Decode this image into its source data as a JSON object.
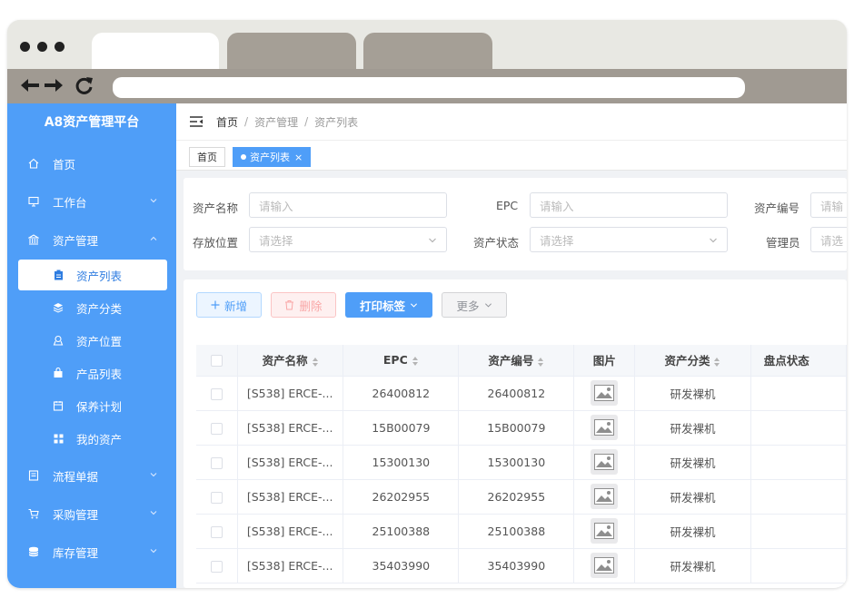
{
  "colors": {
    "primary": "#4f9ef8",
    "sidebar_bg": "#4f9ef8",
    "browser_bar": "#a09a92",
    "danger_light": "#f9a7a7"
  },
  "browser": {
    "icons": [
      "back-icon",
      "forward-icon",
      "reload-icon"
    ]
  },
  "app": {
    "title": "A8资产管理平台"
  },
  "sidebar": {
    "items": [
      {
        "label": "首页",
        "icon": "home-icon"
      },
      {
        "label": "工作台",
        "icon": "monitor-icon"
      },
      {
        "label": "资产管理",
        "icon": "bank-icon"
      },
      {
        "label": "流程单据",
        "icon": "document-icon"
      },
      {
        "label": "采购管理",
        "icon": "cart-icon"
      },
      {
        "label": "库存管理",
        "icon": "database-icon"
      }
    ],
    "sub_items": [
      {
        "label": "资产列表",
        "icon": "clipboard-icon",
        "active": true
      },
      {
        "label": "资产分类",
        "icon": "layers-icon"
      },
      {
        "label": "资产位置",
        "icon": "location-icon"
      },
      {
        "label": "产品列表",
        "icon": "bag-icon"
      },
      {
        "label": "保养计划",
        "icon": "calendar-icon"
      },
      {
        "label": "我的资产",
        "icon": "grid-icon"
      }
    ]
  },
  "breadcrumb": [
    "首页",
    "资产管理",
    "资产列表"
  ],
  "tags": [
    {
      "label": "首页"
    },
    {
      "label": "资产列表",
      "active": true
    }
  ],
  "filters": {
    "asset_name": {
      "label": "资产名称",
      "placeholder": "请输入"
    },
    "epc": {
      "label": "EPC",
      "placeholder": "请输入"
    },
    "asset_code": {
      "label": "资产编号",
      "placeholder": "请输"
    },
    "location": {
      "label": "存放位置",
      "placeholder": "请选择"
    },
    "status": {
      "label": "资产状态",
      "placeholder": "请选择"
    },
    "manager": {
      "label": "管理员",
      "placeholder": "请选"
    }
  },
  "actions": {
    "add": "新增",
    "delete": "删除",
    "print": "打印标签",
    "more": "更多"
  },
  "table": {
    "columns": [
      "资产名称",
      "EPC",
      "资产编号",
      "图片",
      "资产分类",
      "盘点状态"
    ],
    "rows": [
      {
        "name": "[S538] ERCE-...",
        "epc": "26400812",
        "code": "26400812",
        "category": "研发裸机"
      },
      {
        "name": "[S538] ERCE-...",
        "epc": "15B00079",
        "code": "15B00079",
        "category": "研发裸机"
      },
      {
        "name": "[S538] ERCE-...",
        "epc": "15300130",
        "code": "15300130",
        "category": "研发裸机"
      },
      {
        "name": "[S538] ERCE-...",
        "epc": "26202955",
        "code": "26202955",
        "category": "研发裸机"
      },
      {
        "name": "[S538] ERCE-...",
        "epc": "25100388",
        "code": "25100388",
        "category": "研发裸机"
      },
      {
        "name": "[S538] ERCE-...",
        "epc": "35403990",
        "code": "35403990",
        "category": "研发裸机"
      }
    ]
  }
}
